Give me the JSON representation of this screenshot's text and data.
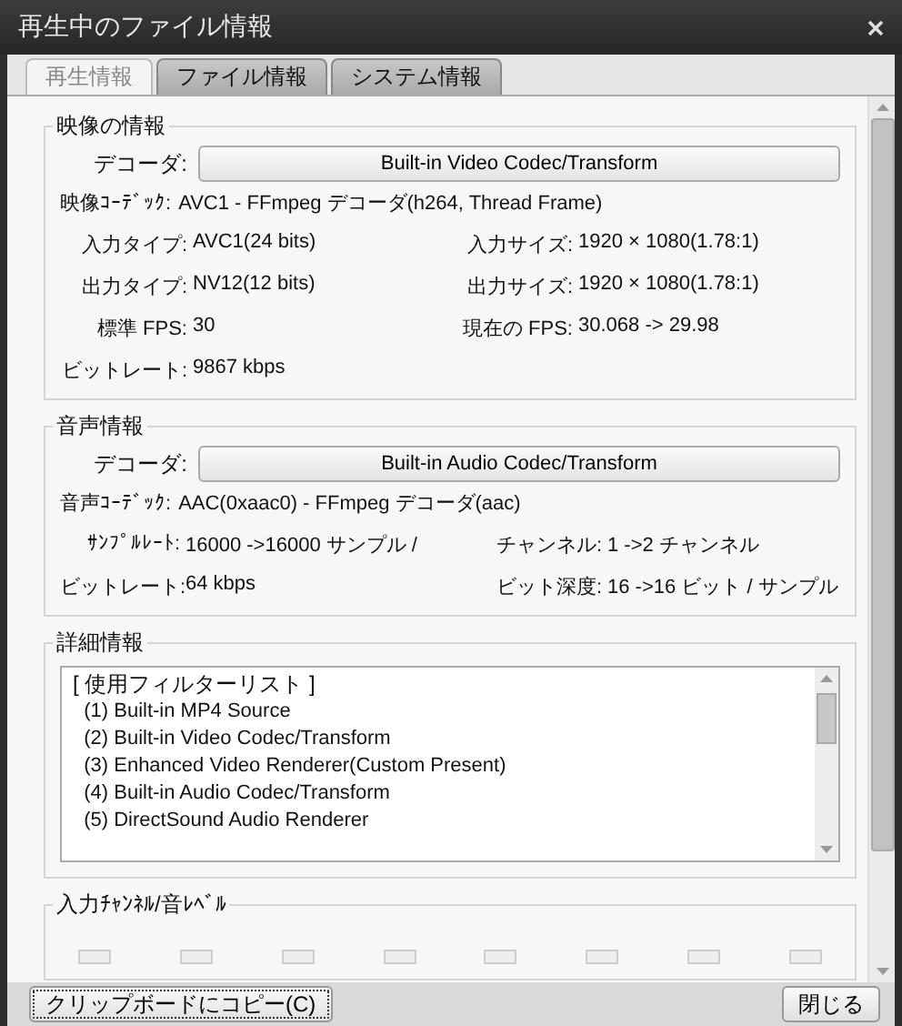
{
  "window": {
    "title": "再生中のファイル情報"
  },
  "tabs": [
    {
      "label": "再生情報",
      "selected": true
    },
    {
      "label": "ファイル情報",
      "selected": false
    },
    {
      "label": "システム情報",
      "selected": false
    }
  ],
  "video": {
    "title": "映像の情報",
    "decoder_label": "デコーダ:",
    "decoder": "Built-in Video Codec/Transform",
    "codec_label": "映像ｺｰﾃﾞｯｸ:",
    "codec": "AVC1 - FFmpeg デコーダ(h264, Thread Frame)",
    "fields": [
      {
        "label": "入力タイプ:",
        "value": "AVC1(24 bits)"
      },
      {
        "label": "入力サイズ:",
        "value": "1920 × 1080(1.78:1)"
      },
      {
        "label": "出力タイプ:",
        "value": "NV12(12 bits)"
      },
      {
        "label": "出力サイズ:",
        "value": "1920 × 1080(1.78:1)"
      },
      {
        "label": "標準 FPS:",
        "value": "30"
      },
      {
        "label": "現在の FPS:",
        "value": "30.068 -> 29.98"
      },
      {
        "label": "ビットレート:",
        "value": "9867 kbps"
      }
    ]
  },
  "audio": {
    "title": "音声情報",
    "decoder_label": "デコーダ:",
    "decoder": "Built-in Audio Codec/Transform",
    "codec_label": "音声ｺｰﾃﾞｯｸ:",
    "codec": "AAC(0xaac0) - FFmpeg デコーダ(aac)",
    "fields": [
      {
        "label": "ｻﾝﾌﾟﾙﾚｰﾄ:",
        "value": "16000 ->16000 サンプル /"
      },
      {
        "label": "チャンネル:",
        "value": "1 ->2 チャンネル"
      },
      {
        "label": "ビットレート:",
        "value": "64 kbps"
      },
      {
        "label": "ビット深度:",
        "value": "16 ->16 ビット / サンプル"
      }
    ]
  },
  "details": {
    "title": "詳細情報",
    "lines": [
      "[ 使用フィルターリスト ]",
      "  (1) Built-in MP4 Source",
      "  (2) Built-in Video Codec/Transform",
      "  (3) Enhanced Video Renderer(Custom Present)",
      "  (4) Built-in Audio Codec/Transform",
      "  (5) DirectSound Audio Renderer"
    ]
  },
  "levels": {
    "title": "入力ﾁｬﾝﾈﾙ/音ﾚﾍﾞﾙ"
  },
  "buttons": {
    "copy": "クリップボードにコピー(C)",
    "close": "閉じる"
  }
}
